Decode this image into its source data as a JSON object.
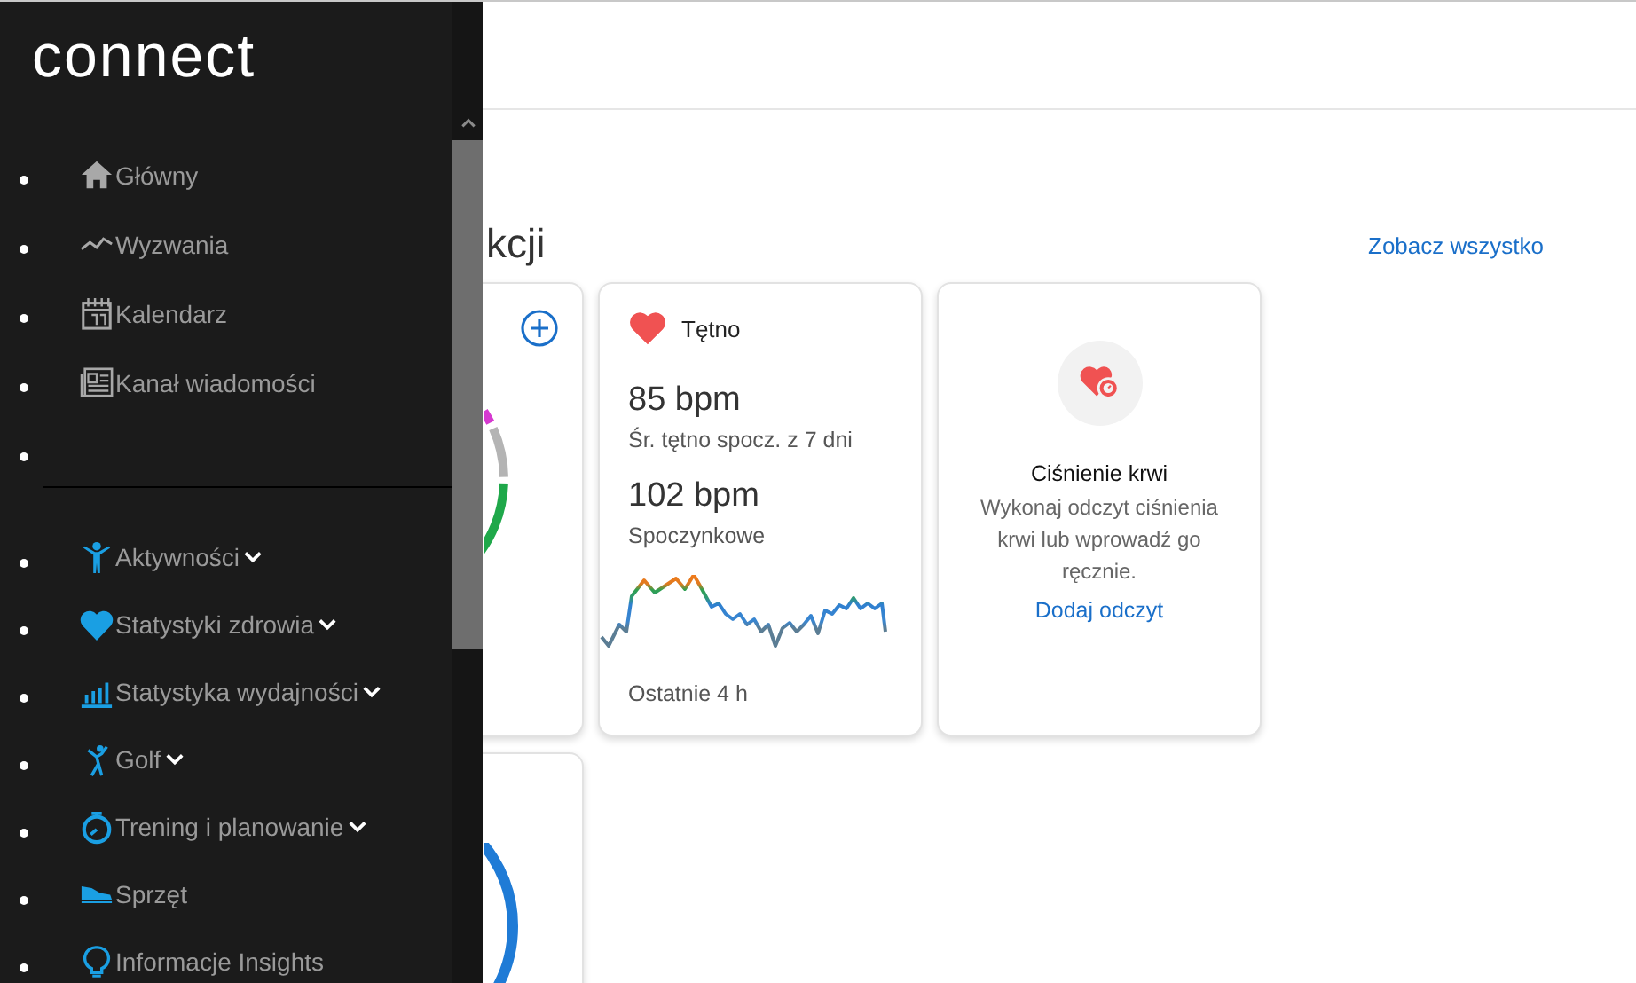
{
  "sidebar": {
    "logo": "connect",
    "sections": [
      {
        "kind": "general",
        "items": [
          {
            "kind": "link",
            "label": "Główny",
            "has_submenu": false
          },
          {
            "kind": "link",
            "label": "Wyzwania",
            "has_submenu": false
          },
          {
            "kind": "link",
            "label": "Kalendarz",
            "has_submenu": false
          },
          {
            "kind": "link",
            "label": "Kanał wiadomości",
            "has_submenu": false
          },
          {
            "kind": "blank"
          }
        ]
      },
      {
        "kind": "features",
        "items": [
          {
            "kind": "link",
            "label": "Aktywności",
            "has_submenu": true
          },
          {
            "kind": "link",
            "label": "Statystyki zdrowia",
            "has_submenu": true
          },
          {
            "kind": "link",
            "label": "Statystyka wydajności",
            "has_submenu": true
          },
          {
            "kind": "link",
            "label": "Golf",
            "has_submenu": true
          },
          {
            "kind": "link",
            "label": "Trening i planowanie",
            "has_submenu": true
          },
          {
            "kind": "link",
            "label": "Sprzęt",
            "has_submenu": false
          },
          {
            "kind": "link",
            "label": "Informacje Insights",
            "has_submenu": false
          }
        ]
      }
    ]
  },
  "main": {
    "section_title": "kcji",
    "see_all": "Zobacz wszystko",
    "cards": [
      {
        "kind": "summary"
      },
      {
        "kind": "heart_rate",
        "title": "Tętno",
        "avg_value": "85 bpm",
        "avg_label": "Śr. tętno spocz. z 7 dni",
        "resting_value": "102 bpm",
        "resting_label": "Spoczynkowe",
        "footer": "Ostatnie 4 h"
      },
      {
        "kind": "blood_pressure",
        "title": "Ciśnienie krwi",
        "text": "Wykonaj odczyt ciśnienia krwi lub wprowadź go ręcznie.",
        "link": "Dodaj odczyt"
      },
      {
        "kind": "ring"
      }
    ]
  }
}
